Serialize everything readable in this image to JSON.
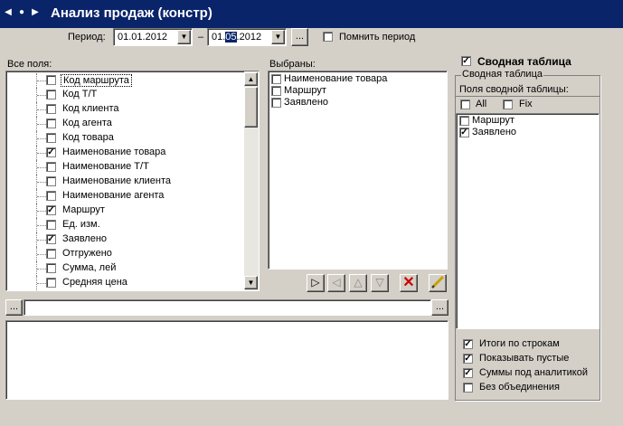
{
  "window": {
    "title": "Анализ продаж (констр)"
  },
  "period": {
    "label": "Период:",
    "from": "01.01.2012",
    "separator": "–",
    "to_prefix": "01.",
    "to_selected": "05",
    "to_suffix": ".2012",
    "ellipsis": "...",
    "remember_label": "Помнить период",
    "remember_checked": false
  },
  "all_fields": {
    "label": "Все поля:",
    "items": [
      {
        "label": "Код маршрута",
        "checked": false
      },
      {
        "label": "Код Т/Т",
        "checked": false
      },
      {
        "label": "Код клиента",
        "checked": false
      },
      {
        "label": "Код агента",
        "checked": false
      },
      {
        "label": "Код товара",
        "checked": false
      },
      {
        "label": "Наименование товара",
        "checked": true
      },
      {
        "label": "Наименование Т/Т",
        "checked": false
      },
      {
        "label": "Наименование клиента",
        "checked": false
      },
      {
        "label": "Наименование агента",
        "checked": false
      },
      {
        "label": "Маршрут",
        "checked": true
      },
      {
        "label": "Ед. изм.",
        "checked": false
      },
      {
        "label": "Заявлено",
        "checked": true
      },
      {
        "label": "Отгружено",
        "checked": false
      },
      {
        "label": "Сумма, лей",
        "checked": false
      },
      {
        "label": "Средняя цена",
        "checked": false
      }
    ]
  },
  "selected": {
    "label": "Выбраны:",
    "items": [
      {
        "label": "Наименование товара",
        "checked": false
      },
      {
        "label": "Маршрут",
        "checked": false
      },
      {
        "label": "Заявлено",
        "checked": false
      }
    ]
  },
  "filter_bar": {
    "left_button": "...",
    "right_button": "...",
    "value": ""
  },
  "pivot": {
    "enabled_label": "Сводная таблица",
    "enabled_checked": true,
    "group_label": "Сводная таблица",
    "fields_label": "Поля сводной таблицы:",
    "all_label": "All",
    "fix_label": "Fix",
    "items": [
      {
        "label": "Маршрут",
        "checked": false
      },
      {
        "label": "Заявлено",
        "checked": true
      }
    ],
    "options": [
      {
        "label": "Итоги по строкам",
        "checked": true
      },
      {
        "label": "Показывать пустые",
        "checked": true
      },
      {
        "label": "Суммы под аналитикой",
        "checked": true
      },
      {
        "label": "Без объединения",
        "checked": false
      }
    ]
  },
  "colors": {
    "title_bg": "#0a246a",
    "face": "#d4d0c8",
    "delete_red": "#cc0000"
  }
}
